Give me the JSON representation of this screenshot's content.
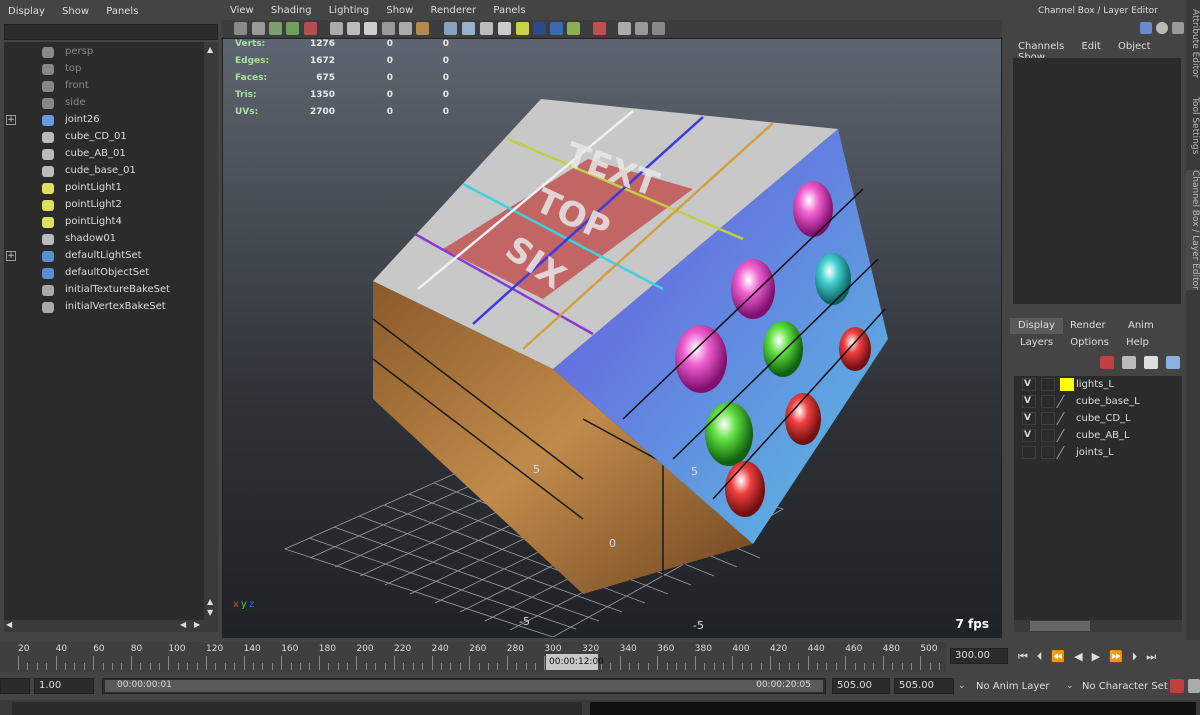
{
  "outliner": {
    "menu": [
      "Display",
      "Show",
      "Panels"
    ],
    "items": [
      {
        "label": "persp",
        "dim": true,
        "icon": "camera-icon",
        "expand": false
      },
      {
        "label": "top",
        "dim": true,
        "icon": "camera-icon",
        "expand": false
      },
      {
        "label": "front",
        "dim": true,
        "icon": "camera-icon",
        "expand": false
      },
      {
        "label": "side",
        "dim": true,
        "icon": "camera-icon",
        "expand": false
      },
      {
        "label": "joint26",
        "dim": false,
        "icon": "joint-icon",
        "expand": true
      },
      {
        "label": "cube_CD_01",
        "dim": false,
        "icon": "mesh-icon",
        "expand": false
      },
      {
        "label": "cube_AB_01",
        "dim": false,
        "icon": "mesh-icon",
        "expand": false
      },
      {
        "label": "cude_base_01",
        "dim": false,
        "icon": "mesh-icon",
        "expand": false
      },
      {
        "label": "pointLight1",
        "dim": false,
        "icon": "light-icon",
        "expand": false
      },
      {
        "label": "pointLight2",
        "dim": false,
        "icon": "light-icon",
        "expand": false
      },
      {
        "label": "pointLight4",
        "dim": false,
        "icon": "light-icon",
        "expand": false
      },
      {
        "label": "shadow01",
        "dim": false,
        "icon": "mesh-icon",
        "expand": false
      },
      {
        "label": "defaultLightSet",
        "dim": false,
        "icon": "set-icon",
        "expand": true
      },
      {
        "label": "defaultObjectSet",
        "dim": false,
        "icon": "set-icon",
        "expand": false
      },
      {
        "label": "initialTextureBakeSet",
        "dim": false,
        "icon": "bakeset-icon",
        "expand": false
      },
      {
        "label": "initialVertexBakeSet",
        "dim": false,
        "icon": "bakeset-icon",
        "expand": false
      }
    ]
  },
  "viewport": {
    "menu": [
      "View",
      "Shading",
      "Lighting",
      "Show",
      "Renderer",
      "Panels"
    ],
    "hud": [
      {
        "label": "Verts:",
        "v": [
          "1276",
          "0",
          "0"
        ]
      },
      {
        "label": "Edges:",
        "v": [
          "1672",
          "0",
          "0"
        ]
      },
      {
        "label": "Faces:",
        "v": [
          "675",
          "0",
          "0"
        ]
      },
      {
        "label": "Tris:",
        "v": [
          "1350",
          "0",
          "0"
        ]
      },
      {
        "label": "UVs:",
        "v": [
          "2700",
          "0",
          "0"
        ]
      }
    ],
    "cube_text": [
      "TEXT",
      "TOP",
      "SIX"
    ],
    "grid_labels": [
      "5",
      "5",
      "0",
      "-5",
      "-5"
    ],
    "fps": "7 fps",
    "axis": [
      "x",
      "y",
      "z"
    ]
  },
  "right": {
    "title": "Channel Box / Layer Editor",
    "menu": [
      "Channels",
      "Edit",
      "Object",
      "Show"
    ],
    "vtabs": [
      "Attribute Editor",
      "Tool Settings",
      "Channel Box / Layer Editor"
    ],
    "tabs": [
      "Display",
      "Render",
      "Anim"
    ],
    "layer_menu": [
      "Layers",
      "Options",
      "Help"
    ],
    "layers": [
      {
        "vis": "V",
        "name": "lights_L",
        "color": "#ffff00"
      },
      {
        "vis": "V",
        "name": "cube_base_L",
        "color": ""
      },
      {
        "vis": "V",
        "name": "cube_CD_L",
        "color": ""
      },
      {
        "vis": "V",
        "name": "cube_AB_L",
        "color": ""
      },
      {
        "vis": "",
        "name": "joints_L",
        "color": ""
      }
    ]
  },
  "timeline": {
    "ticks": [
      "20",
      "40",
      "60",
      "80",
      "100",
      "120",
      "140",
      "160",
      "180",
      "200",
      "220",
      "240",
      "260",
      "280",
      "300",
      "320",
      "340",
      "360",
      "380",
      "400",
      "420",
      "440",
      "460",
      "480",
      "500"
    ],
    "current_time": "00:00:12:00",
    "end_field": "300.00"
  },
  "range": {
    "start": "1.00",
    "start_time": "00:00:00:01",
    "end_time": "00:00:20:05",
    "f1": "505.00",
    "f2": "505.00",
    "anim_layer": "No Anim Layer",
    "char_set": "No Character Set"
  }
}
